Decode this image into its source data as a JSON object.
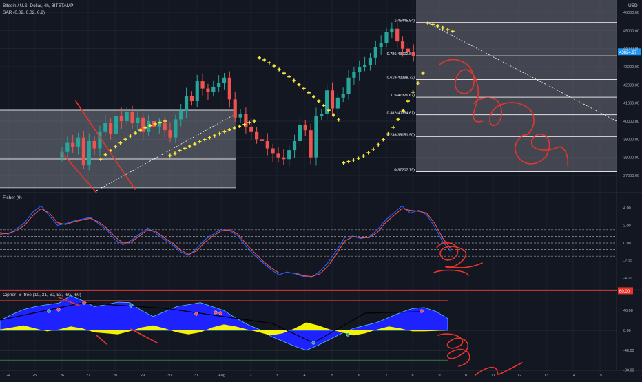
{
  "header": {
    "title": "Bitcoin / U.S. Dollar, 4h, BITSTAMP",
    "sar_label": "SAR (0.02, 0.02, 0.2)",
    "currency": "USD"
  },
  "fisher": {
    "label": "Fisher (9)"
  },
  "cipher": {
    "label": "Cipher_B_free (10, 21, 60, 53, -60, -60)"
  },
  "colors": {
    "background": "#131722",
    "up": "#26a69a",
    "down": "#ef5350",
    "sar": "#f5e642",
    "fib_zone": "#6b6e78",
    "drawing": "#e8352b",
    "fisher_blue": "#2962ff",
    "fisher_red": "#ef5350",
    "wave_blue": "#1e22ff",
    "wave_yellow": "#ffff00",
    "current_price_tag": "#2196f3"
  },
  "fib_levels": [
    {
      "label": "1(45445.54)",
      "price": 45445.54
    },
    {
      "label": "0.786(43602.66)",
      "price": 43602.66
    },
    {
      "label": "0.618(42298.72)",
      "price": 42298.72
    },
    {
      "label": "0.5(41326.67)",
      "price": 41326.67
    },
    {
      "label": "0.382(40354.61)",
      "price": 40354.61
    },
    {
      "label": "0.236(39151.90)",
      "price": 39151.9
    },
    {
      "label": "0(37207.79)",
      "price": 37207.79
    }
  ],
  "current_price_label": "43824.97",
  "cipher_level_label": "60.00",
  "chart_data": [
    {
      "type": "candlestick",
      "title": "Bitcoin / U.S. Dollar, 4h, BITSTAMP",
      "ylabel": "USD",
      "ylim": [
        36500,
        46500
      ],
      "y_ticks": [
        "46000.00",
        "45000.00",
        "44000.00",
        "43000.00",
        "42000.00",
        "41000.00",
        "40000.00",
        "39000.00",
        "38000.00",
        "37000.00"
      ],
      "x_ticks": [
        "24",
        "25",
        "26",
        "27",
        "28",
        "29",
        "30",
        "31",
        "Aug",
        "2",
        "3",
        "4",
        "5",
        "6",
        "7",
        "8",
        "9",
        "10",
        "11",
        "12",
        "13",
        "14",
        "15"
      ],
      "candles_close": [
        38300,
        38800,
        38600,
        39100,
        37600,
        38900,
        38500,
        39400,
        39900,
        39300,
        40300,
        40000,
        40500,
        39900,
        40200,
        39400,
        40000,
        39700,
        39900,
        39500,
        39100,
        40100,
        40600,
        41400,
        41100,
        42200,
        41800,
        41600,
        41900,
        42100,
        42400,
        41200,
        40200,
        40400,
        39700,
        39400,
        39000,
        38900,
        38500,
        38200,
        38000,
        37900,
        38400,
        38900,
        39800,
        39500,
        38000,
        40300,
        40400,
        41700,
        40700,
        41300,
        41500,
        42400,
        42700,
        43000,
        43100,
        43500,
        44100,
        44300,
        44900,
        45100,
        44400,
        44000,
        43800,
        43600
      ],
      "sar": [
        37900,
        38150,
        38380,
        38600,
        38800,
        39000,
        39180,
        39350,
        39500,
        39630,
        39750,
        39850,
        39930,
        40000,
        38100,
        38220,
        38380,
        38500,
        38620,
        38740,
        38870,
        38980,
        39090,
        39200,
        39310,
        39420,
        39520,
        39620,
        39720,
        39820,
        39920,
        40000,
        43500,
        43380,
        43220,
        43040,
        42850,
        42650,
        42450,
        42240,
        42020,
        41800,
        41570,
        41340,
        41100,
        40860,
        40600,
        40340,
        40070,
        37700,
        37770,
        37850,
        37950,
        38080,
        38250,
        38450,
        38700,
        38980,
        39300,
        39660,
        40100,
        40580,
        41100,
        41600,
        42100,
        42650,
        45400,
        45330,
        45250,
        45150,
        45050,
        44960
      ],
      "sar_note": "values estimated from the chart"
    },
    {
      "type": "line",
      "title": "Fisher (9)",
      "ylim": [
        -4.8,
        4.8
      ],
      "y_ticks": [
        "4.00",
        "2.00",
        "0.00",
        "-2.00",
        "-4.00"
      ],
      "series": [
        {
          "values": [
            1.2,
            1.0,
            1.6,
            2.3,
            3.5,
            4.2,
            3.1,
            2.0,
            2.2,
            2.5,
            2.7,
            2.9,
            2.2,
            1.5,
            0.4,
            -0.2,
            0.3,
            1.0,
            1.7,
            1.1,
            0.4,
            -0.2,
            -1.0,
            -1.4,
            -0.6,
            0.4,
            1.0,
            1.6,
            1.4,
            0.8,
            -0.4,
            -1.4,
            -2.2,
            -3.0,
            -3.6,
            -3.3,
            -3.5,
            -3.8,
            -3.9,
            -3.2,
            -2.2,
            -0.9,
            0.6,
            0.8,
            0.5,
            0.7,
            1.5,
            2.6,
            3.4,
            4.2,
            3.4,
            3.7,
            3.2,
            1.8,
            0.1,
            -1.0
          ]
        },
        {
          "values": [
            1.0,
            1.1,
            1.4,
            2.0,
            3.1,
            3.9,
            3.4,
            2.3,
            2.1,
            2.4,
            2.6,
            2.8,
            2.4,
            1.7,
            0.7,
            0.0,
            0.1,
            0.8,
            1.5,
            1.3,
            0.6,
            0.0,
            -0.8,
            -1.3,
            -0.9,
            0.1,
            0.8,
            1.4,
            1.5,
            1.0,
            -0.1,
            -1.1,
            -2.0,
            -2.8,
            -3.4,
            -3.4,
            -3.4,
            -3.7,
            -3.8,
            -3.5,
            -2.6,
            -1.3,
            0.2,
            0.7,
            0.6,
            0.6,
            1.2,
            2.3,
            3.1,
            3.9,
            3.7,
            3.6,
            3.4,
            2.2,
            0.5,
            -0.7
          ]
        }
      ],
      "levels": [
        1.5,
        0.75,
        -0.75,
        -1.5
      ]
    },
    {
      "type": "area",
      "title": "Cipher_B_free (10, 21, 60, 53, -60, -60)",
      "ylim": [
        -90,
        95
      ],
      "y_ticks": [
        "40.00",
        "0.00",
        "-40.00",
        "-80.00"
      ],
      "series": [
        {
          "values": [
            20,
            32,
            42,
            48,
            52,
            55,
            70,
            60,
            48,
            52,
            57,
            56,
            40,
            28,
            38,
            48,
            52,
            56,
            48,
            40,
            25,
            12,
            2,
            -12,
            -22,
            -32,
            -40,
            -30,
            -18,
            -6,
            4,
            10,
            16,
            26,
            36,
            44,
            46,
            38,
            24
          ]
        },
        {
          "values": [
            2,
            6,
            10,
            4,
            -2,
            2,
            8,
            4,
            -4,
            -6,
            -8,
            -2,
            6,
            10,
            4,
            -4,
            -8,
            -4,
            6,
            12,
            8,
            2,
            -4,
            -10,
            -6,
            4,
            16,
            10,
            2,
            -4,
            -10,
            -6,
            2,
            8,
            4,
            -2,
            -2,
            -1,
            0
          ]
        }
      ],
      "levels": [
        80,
        60,
        -60,
        -70
      ]
    }
  ]
}
